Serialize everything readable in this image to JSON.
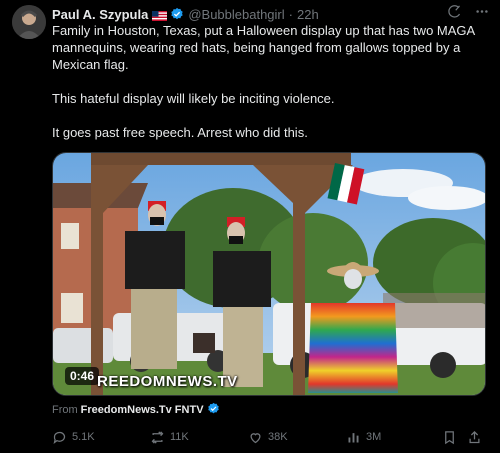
{
  "tweet": {
    "author_name": "Paul A. Szypula",
    "handle": "@Bubblebathgirl",
    "separator": "·",
    "time": "22h",
    "paragraphs": [
      "Family in Houston, Texas, put a Halloween display up that has two MAGA mannequins, wearing red hats, being hanged from gallows topped by a Mexican flag.",
      "This hateful display will likely be inciting violence.",
      "It goes past free speech. Arrest who did this."
    ]
  },
  "media": {
    "duration": "0:46",
    "watermark": "REEDOMNEWS.TV"
  },
  "source": {
    "prefix": "From",
    "name": "FreedomNews.Tv FNTV"
  },
  "actions": {
    "replies": "5.1K",
    "reposts": "11K",
    "likes": "38K",
    "views": "3M"
  },
  "colors": {
    "background": "#000000",
    "verified": "#1d9bf0",
    "muted": "#71767b"
  },
  "icons": [
    "grok-icon",
    "more-icon",
    "reply-icon",
    "repost-icon",
    "like-icon",
    "views-icon",
    "bookmark-icon",
    "share-icon"
  ]
}
